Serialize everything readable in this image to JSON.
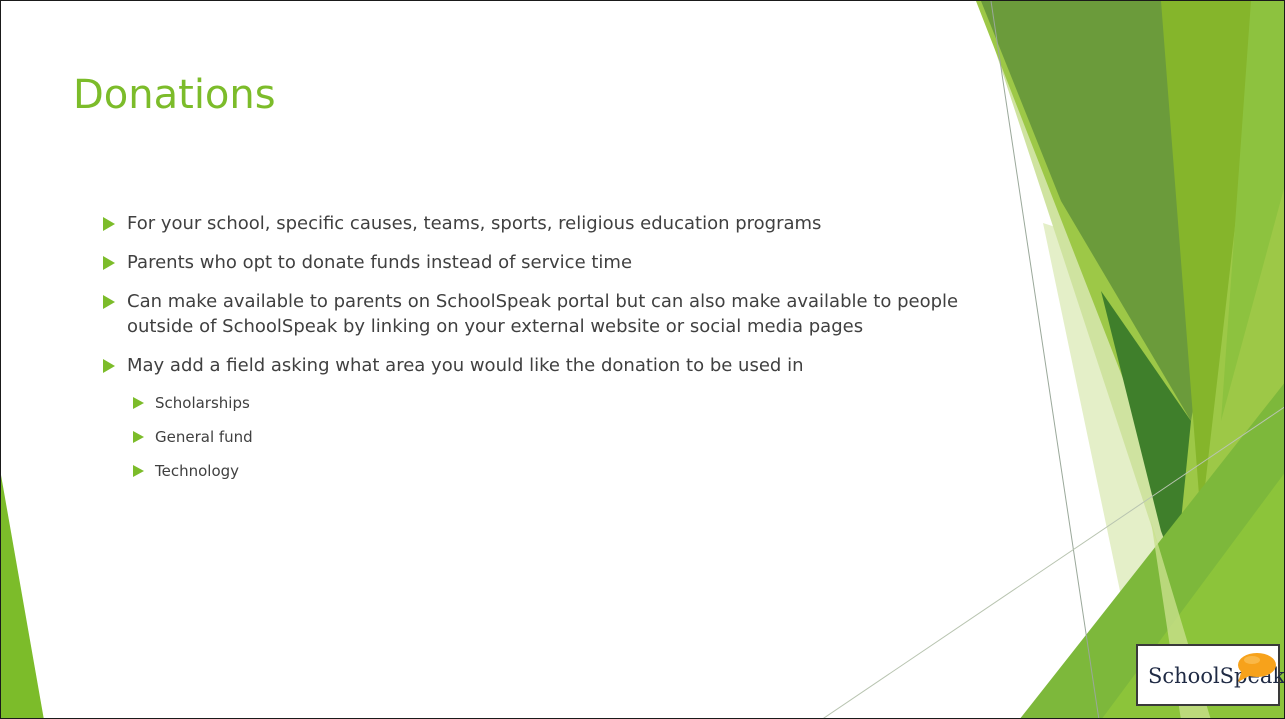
{
  "slide": {
    "title": "Donations",
    "bullets": [
      "For your school, specific causes, teams, sports, religious education programs",
      "Parents who opt to donate funds instead of service time",
      "Can make available to parents on SchoolSpeak portal but can also make available to people outside of SchoolSpeak by linking on your external website or social media pages",
      "May add a field asking what area you would like the donation to be used in"
    ],
    "sub_bullets": [
      "Scholarships",
      "General fund",
      "Technology"
    ],
    "bullet_icon": "triangle-arrow-icon"
  },
  "logo": {
    "text": "SchoolSpeak",
    "icon": "speech-bubble-icon",
    "bubble_color": "#f7a21b"
  },
  "colors": {
    "accent": "#7cbc2a",
    "text": "#404040",
    "decor_green": [
      "#7cbc2a",
      "#5f9e2e",
      "#a7d24a",
      "#dbe9b3",
      "#3c7f2a"
    ]
  }
}
